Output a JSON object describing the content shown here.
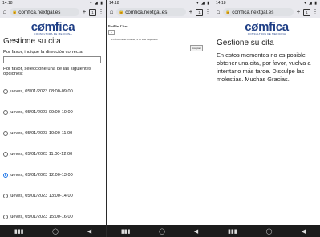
{
  "status_bar": {
    "time": "14:18",
    "icons": "▾ ◢ ▮"
  },
  "browser": {
    "url": "comfica.nextgal.es",
    "lock_icon": "lock-icon",
    "home_icon": "⌂",
    "add_icon": "+",
    "tab_count": "1",
    "menu_icon": "⋮"
  },
  "brand": {
    "logo": "cømfica",
    "tagline": "CONSULTORA DE MEDICINA"
  },
  "screen1": {
    "title": "Gestione su cita",
    "address_label": "Por favor, indique la dirección correcta",
    "address_value": "",
    "select_label": "Por favor, seleccione una de las siguientes opciones:",
    "options": [
      {
        "label": "jueves, 05/01/2023 08:00-09:00",
        "checked": false
      },
      {
        "label": "jueves, 05/01/2023 09:00-10:00",
        "checked": false
      },
      {
        "label": "jueves, 05/01/2023 10:00-11:00",
        "checked": false
      },
      {
        "label": "jueves, 05/01/2023 11:00-12:00",
        "checked": false
      },
      {
        "label": "jueves, 05/01/2023 12:00-13:00",
        "checked": true
      },
      {
        "label": "jueves, 05/01/2023 13:00-14:00",
        "checked": false
      },
      {
        "label": "jueves, 05/01/2023 15:00-16:00",
        "checked": false
      }
    ]
  },
  "screen2": {
    "title": "Posibles Citas",
    "small_button": "▸",
    "message": "La fecha seleccionada ya no está disponible",
    "accept_button": "Aceptar"
  },
  "screen3": {
    "title": "Gestione su cita",
    "message": "En estos momentos no es posible obtener una cita, por favor, vuelva a intentarlo más tarde. Disculpe las molestias. Muchas Gracias."
  },
  "nav": {
    "recents": "▮▮▮",
    "home": "◯",
    "back": "◀"
  }
}
